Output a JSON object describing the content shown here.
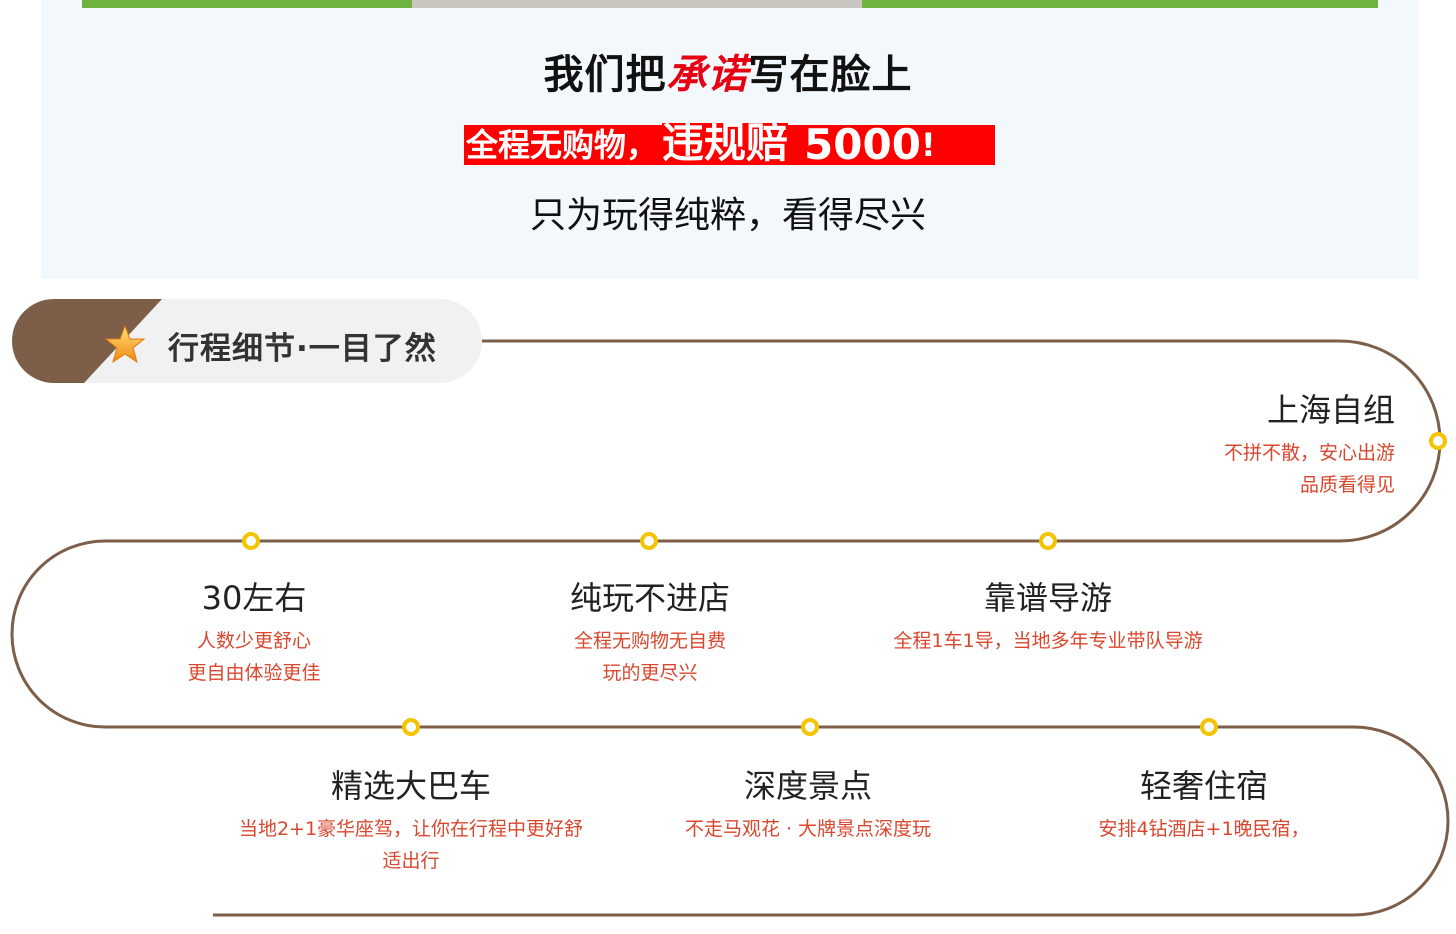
{
  "promo": {
    "headline_part1": "我们把",
    "headline_highlight": "承诺",
    "headline_part2": "写在脸上",
    "penalty_part1": "全程无购物，",
    "penalty_part2": "违规赔",
    "penalty_amount": "5000",
    "penalty_end": "!",
    "subline": "只为玩得纯粹，看得尽兴"
  },
  "section": {
    "title": "行程细节·一目了然",
    "icon": "star-icon"
  },
  "stops": [
    {
      "name": "上海自组",
      "desc_lines": [
        "不拼不散，安心出游",
        "品质看得见"
      ]
    },
    {
      "name": "30左右",
      "desc_lines": [
        "人数少更舒心",
        "更自由体验更佳"
      ]
    },
    {
      "name": "纯玩不进店",
      "desc_lines": [
        "全程无购物无自费",
        "玩的更尽兴"
      ]
    },
    {
      "name": "靠谱导游",
      "desc_lines": [
        "全程1车1导，当地多年专业带队导游"
      ]
    },
    {
      "name": "精选大巴车",
      "desc_lines": [
        "当地2+1豪华座驾，让你在行程中更好舒",
        "适出行"
      ]
    },
    {
      "name": "深度景点",
      "desc_lines": [
        "不走马观花 · 大牌景点深度玩"
      ]
    },
    {
      "name": "轻奢住宿",
      "desc_lines": [
        "安排4钻酒店+1晚民宿，"
      ]
    }
  ],
  "colors": {
    "track": "#7d5f49",
    "dot": "#f5c400",
    "accent_red": "#e60012",
    "desc_red": "#d9472e",
    "banner_green": "#6cb33f"
  }
}
